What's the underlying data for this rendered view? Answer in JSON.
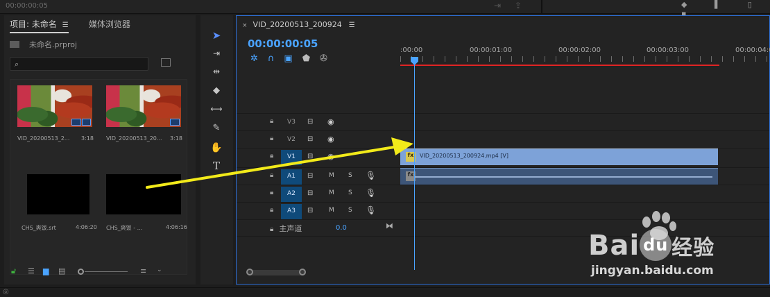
{
  "topbar": {
    "timecode": "00:00:00:05"
  },
  "project_panel": {
    "tabs": [
      "项目: 未命名",
      "媒体浏览器"
    ],
    "project_file": "未命名.prproj",
    "search_placeholder": "",
    "items": [
      {
        "name": "VID_20200513_2...",
        "duration": "3:18",
        "kind": "video"
      },
      {
        "name": "VID_20200513_20...",
        "duration": "3:18",
        "kind": "video"
      },
      {
        "name": "CHS_爽饭.srt",
        "duration": "4:06:20",
        "kind": "caption"
      },
      {
        "name": "CHS_爽饭 - ...",
        "duration": "4:06:16",
        "kind": "caption"
      }
    ]
  },
  "tools": [
    "selection-tool",
    "track-select-tool",
    "ripple-edit-tool",
    "razor-tool",
    "slip-tool",
    "pen-tool",
    "hand-tool",
    "type-tool"
  ],
  "timeline": {
    "sequence_name": "VID_20200513_200924",
    "timecode": "00:00:00:05",
    "ruler": [
      ":00:00",
      "00:00:01:00",
      "00:00:02:00",
      "00:00:03:00",
      "00:00:04:0"
    ],
    "video_tracks": [
      "V3",
      "V2",
      "V1"
    ],
    "audio_tracks": [
      "A1",
      "A2",
      "A3"
    ],
    "mute_label": "M",
    "solo_label": "S",
    "master_label": "主声道",
    "master_value": "0.0",
    "video_clip_label": "VID_20200513_200924.mp4 [V]",
    "fx_label": "fx"
  },
  "watermark": {
    "brand": "Bai",
    "brand_suffix": "经验",
    "du_mark": "du",
    "url": "jingyan.baidu.com"
  },
  "colors": {
    "accent_blue": "#4aa3ff",
    "work_area_red": "#e02424",
    "arrow_yellow": "#f2ea1a",
    "video_clip": "#7da2d8",
    "audio_clip": "#3d5578"
  }
}
